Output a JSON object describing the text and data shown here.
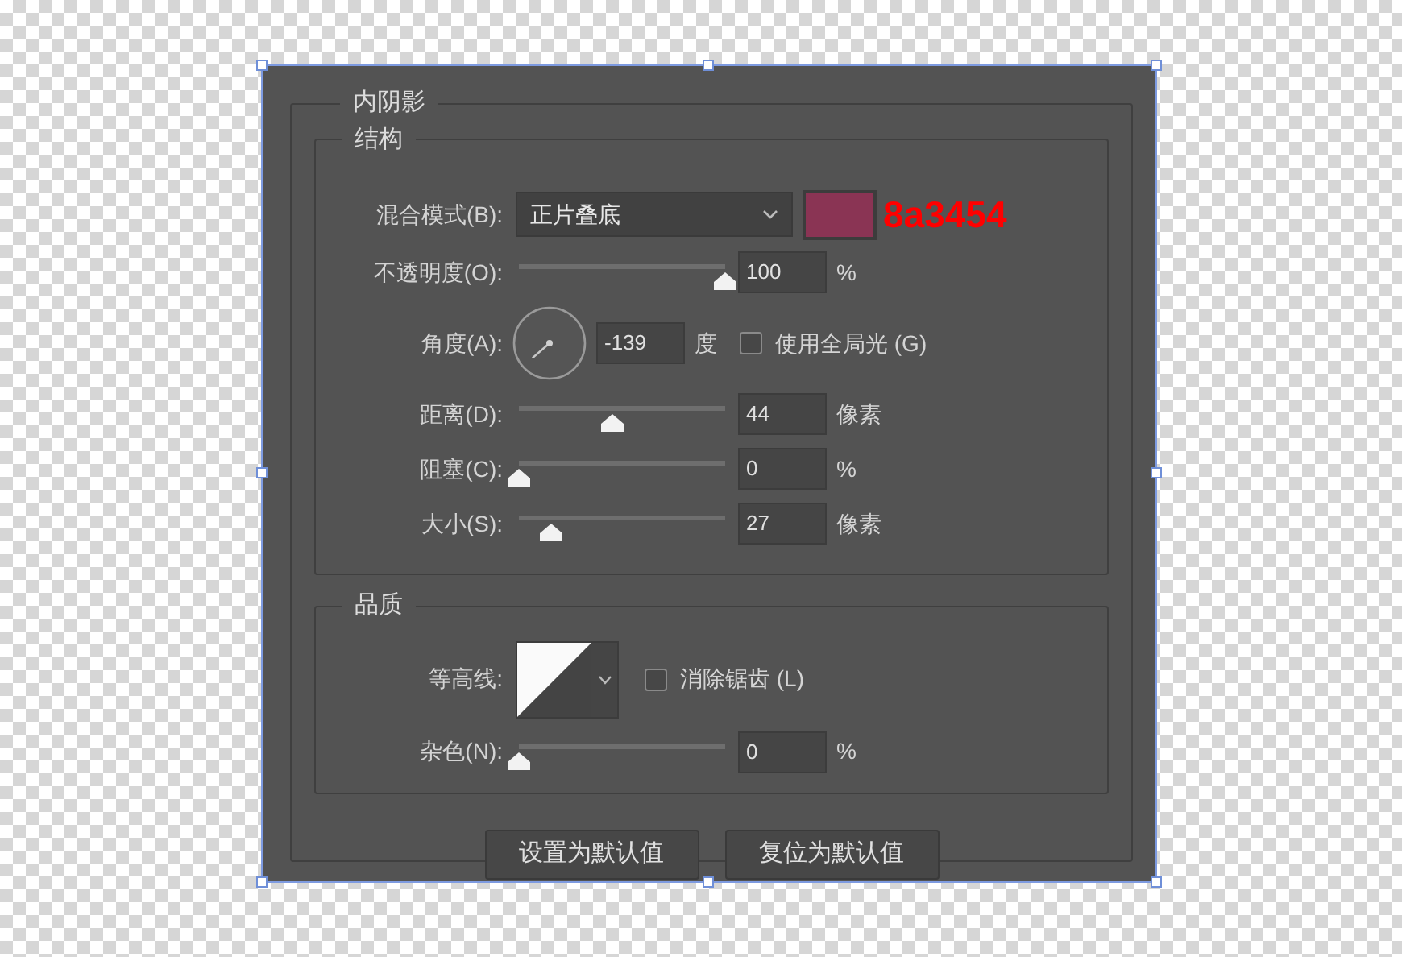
{
  "dialog": {
    "title": "内阴影",
    "structure": {
      "title": "结构",
      "rows": [
        {
          "kind": "select",
          "label": "混合模式(B):",
          "value": "正片叠底",
          "color": "#8a3454",
          "note": "8a3454"
        },
        {
          "kind": "slider",
          "label": "不透明度(O):",
          "level": 1,
          "value": "100",
          "unit": "%"
        },
        {
          "kind": "angle",
          "label": "角度(A):",
          "value": "-139",
          "unit": "度",
          "checkbox": {
            "label": "使用全局光 (G)",
            "checked": false
          }
        },
        {
          "kind": "slider",
          "label": "距离(D):",
          "level": 0.45,
          "value": "44",
          "unit": "像素"
        },
        {
          "kind": "slider",
          "label": "阻塞(C):",
          "level": 0,
          "value": "0",
          "unit": "%"
        },
        {
          "kind": "slider",
          "label": "大小(S):",
          "level": 0.16,
          "value": "27",
          "unit": "像素"
        }
      ]
    },
    "quality": {
      "title": "品质",
      "rows": [
        {
          "kind": "contour",
          "label": "等高线:",
          "checkbox": {
            "label": "消除锯齿 (L)",
            "checked": false
          }
        },
        {
          "kind": "slider",
          "label": "杂色(N):",
          "level": 0,
          "value": "0",
          "unit": "%"
        }
      ]
    },
    "buttons": [
      "设置为默认值",
      "复位为默认值"
    ]
  }
}
